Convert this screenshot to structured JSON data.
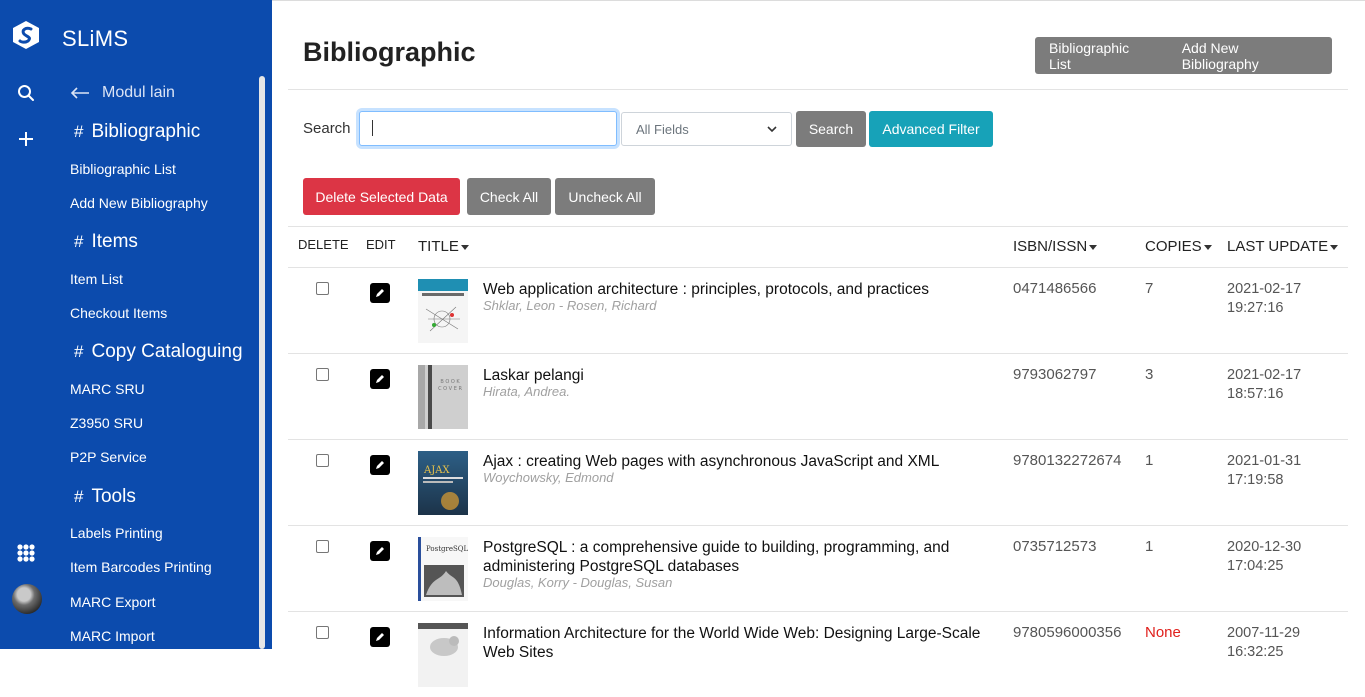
{
  "app": {
    "name": "SLiMS"
  },
  "sidebar": {
    "back_label": "Modul lain",
    "sections": [
      {
        "title": "Bibliographic",
        "items": [
          "Bibliographic List",
          "Add New Bibliography"
        ]
      },
      {
        "title": "Items",
        "items": [
          "Item List",
          "Checkout Items"
        ]
      },
      {
        "title": "Copy Cataloguing",
        "items": [
          "MARC SRU",
          "Z3950 SRU",
          "P2P Service"
        ]
      },
      {
        "title": "Tools",
        "items": [
          "Labels Printing",
          "Item Barcodes Printing",
          "MARC Export",
          "MARC Import"
        ]
      }
    ],
    "hash": "#"
  },
  "page": {
    "title": "Bibliographic",
    "actions": {
      "list": "Bibliographic List",
      "add": "Add New Bibliography"
    }
  },
  "search": {
    "label": "Search",
    "value": "",
    "field_select": "All Fields",
    "search_button": "Search",
    "advanced_button": "Advanced Filter"
  },
  "bulk": {
    "delete": "Delete Selected Data",
    "check_all": "Check All",
    "uncheck_all": "Uncheck All"
  },
  "table": {
    "headers": {
      "delete": "DELETE",
      "edit": "EDIT",
      "title": "TITLE",
      "isbn": "ISBN/ISSN",
      "copies": "COPIES",
      "last_update": "LAST UPDATE"
    },
    "rows": [
      {
        "title": "Web application architecture : principles, protocols, and practices",
        "author": "Shklar, Leon - Rosen, Richard",
        "isbn": "0471486566",
        "copies": "7",
        "date": "2021-02-17",
        "time": "19:27:16"
      },
      {
        "title": "Laskar pelangi",
        "author": "Hirata, Andrea.",
        "isbn": "9793062797",
        "copies": "3",
        "date": "2021-02-17",
        "time": "18:57:16"
      },
      {
        "title": "Ajax : creating Web pages with asynchronous JavaScript and XML",
        "author": "Woychowsky, Edmond",
        "isbn": "9780132272674",
        "copies": "1",
        "date": "2021-01-31",
        "time": "17:19:58"
      },
      {
        "title": "PostgreSQL : a comprehensive guide to building, programming, and administering PostgreSQL databases",
        "author": "Douglas, Korry - Douglas, Susan",
        "isbn": "0735712573",
        "copies": "1",
        "date": "2020-12-30",
        "time": "17:04:25"
      },
      {
        "title": "Information Architecture for the World Wide Web: Designing Large-Scale Web Sites",
        "author": "",
        "isbn": "9780596000356",
        "copies": "None",
        "date": "2007-11-29",
        "time": "16:32:25"
      }
    ]
  },
  "colors": {
    "sidebar": "#0c4bad",
    "danger": "#dc3545",
    "info": "#17a2b8",
    "grey": "#7c7c7c",
    "none": "#e0201c"
  }
}
